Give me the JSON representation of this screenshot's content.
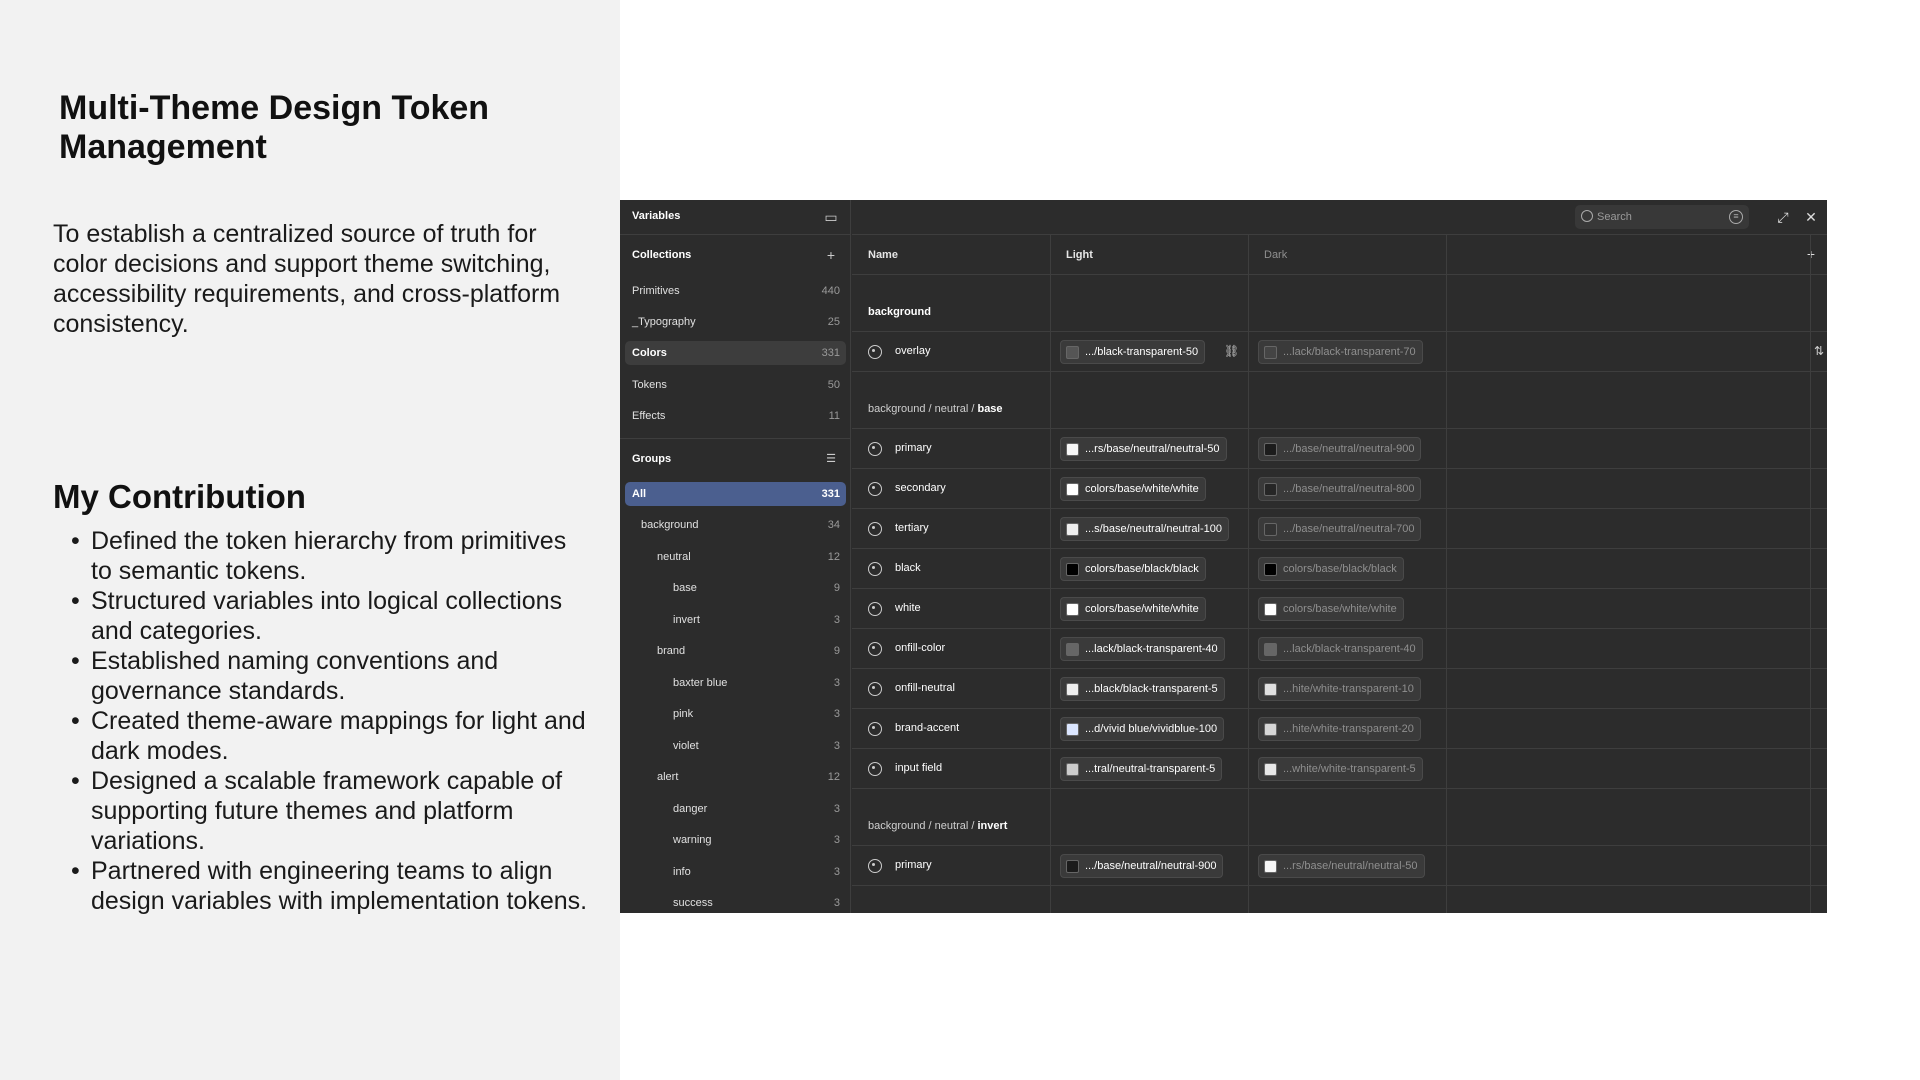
{
  "slide": {
    "title": "Multi-Theme Design Token Management",
    "intro": "To establish a centralized source of truth for color decisions and support theme switching, accessibility requirements, and cross-platform consistency.",
    "contribution_title": "My Contribution",
    "contributions": [
      "Defined the token hierarchy from primitives to semantic tokens.",
      "Structured variables into logical collections and categories.",
      "Established naming conventions and governance standards.",
      "Created theme-aware mappings for light and dark modes.",
      "Designed a scalable framework capable of supporting future themes and platform variations.",
      "Partnered with engineering teams to align design variables with implementation tokens."
    ]
  },
  "app": {
    "panel_title": "Variables",
    "collections_label": "Collections",
    "collections": [
      {
        "label": "Primitives",
        "count": "440"
      },
      {
        "label": "_Typography",
        "count": "25"
      },
      {
        "label": "Colors",
        "count": "331"
      },
      {
        "label": "Tokens",
        "count": "50"
      },
      {
        "label": "Effects",
        "count": "11"
      }
    ],
    "groups_label": "Groups",
    "groups": [
      {
        "label": "All",
        "count": "331"
      },
      {
        "label": "background",
        "count": "34"
      },
      {
        "label": "neutral",
        "count": "12"
      },
      {
        "label": "base",
        "count": "9"
      },
      {
        "label": "invert",
        "count": "3"
      },
      {
        "label": "brand",
        "count": "9"
      },
      {
        "label": "baxter blue",
        "count": "3"
      },
      {
        "label": "pink",
        "count": "3"
      },
      {
        "label": "violet",
        "count": "3"
      },
      {
        "label": "alert",
        "count": "12"
      },
      {
        "label": "danger",
        "count": "3"
      },
      {
        "label": "warning",
        "count": "3"
      },
      {
        "label": "info",
        "count": "3"
      },
      {
        "label": "success",
        "count": "3"
      }
    ],
    "search_placeholder": "Search",
    "columns": {
      "name": "Name",
      "light": "Light",
      "dark": "Dark"
    },
    "group_headers": {
      "g1": {
        "path": "background",
        "bold": ""
      },
      "g2": {
        "path": "background / neutral / ",
        "bold": "base"
      },
      "g3": {
        "path": "background / neutral / ",
        "bold": "invert"
      }
    },
    "rows": [
      {
        "name": "overlay",
        "light": ".../black-transparent-50",
        "dark": "...lack/black-transparent-70",
        "light_swatch": "#555555",
        "dark_swatch": "#444444"
      },
      {
        "name": "primary",
        "light": "...rs/base/neutral/neutral-50",
        "dark": ".../base/neutral/neutral-900",
        "light_swatch": "#f7f7f7",
        "dark_swatch": "#1c1c1c"
      },
      {
        "name": "secondary",
        "light": "colors/base/white/white",
        "dark": ".../base/neutral/neutral-800",
        "light_swatch": "#ffffff",
        "dark_swatch": "#262626"
      },
      {
        "name": "tertiary",
        "light": "...s/base/neutral/neutral-100",
        "dark": ".../base/neutral/neutral-700",
        "light_swatch": "#efefef",
        "dark_swatch": "#333333"
      },
      {
        "name": "black",
        "light": "colors/base/black/black",
        "dark": "colors/base/black/black",
        "light_swatch": "#000000",
        "dark_swatch": "#000000"
      },
      {
        "name": "white",
        "light": "colors/base/white/white",
        "dark": "colors/base/white/white",
        "light_swatch": "#ffffff",
        "dark_swatch": "#ffffff"
      },
      {
        "name": "onfill-color",
        "light": "...lack/black-transparent-40",
        "dark": "...lack/black-transparent-40",
        "light_swatch": "#666666",
        "dark_swatch": "#666666"
      },
      {
        "name": "onfill-neutral",
        "light": "...black/black-transparent-5",
        "dark": "...hite/white-transparent-10",
        "light_swatch": "#eeeeee",
        "dark_swatch": "#e0e0e0"
      },
      {
        "name": "brand-accent",
        "light": "...d/vivid blue/vividblue-100",
        "dark": "...hite/white-transparent-20",
        "light_swatch": "#dbe6ff",
        "dark_swatch": "#d6d6d6"
      },
      {
        "name": "input field",
        "light": "...tral/neutral-transparent-5",
        "dark": "...white/white-transparent-5",
        "light_swatch": "#cccccc",
        "dark_swatch": "#e8e8e8"
      },
      {
        "name": "primary",
        "light": ".../base/neutral/neutral-900",
        "dark": "...rs/base/neutral/neutral-50",
        "light_swatch": "#1c1c1c",
        "dark_swatch": "#f7f7f7"
      }
    ]
  }
}
